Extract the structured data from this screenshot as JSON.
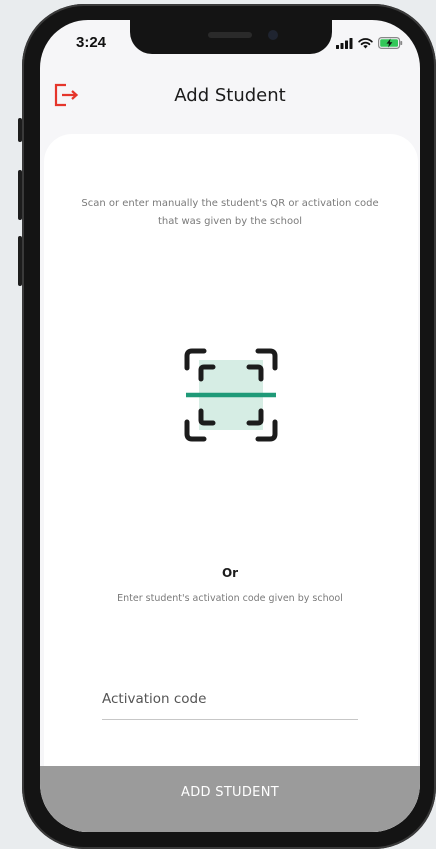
{
  "status_bar": {
    "time": "3:24",
    "icons": [
      "signal-icon",
      "wifi-icon",
      "battery-charging-icon"
    ]
  },
  "header": {
    "title": "Add Student",
    "logout_icon": "logout-icon"
  },
  "main": {
    "instructions": "Scan or enter manually the student's QR or activation code that was given by the school",
    "qr_icon": "qr-scan-icon",
    "or_label": "Or",
    "enter_text": "Enter student's activation code given by school",
    "activation_placeholder": "Activation code",
    "activation_value": ""
  },
  "footer": {
    "add_button_label": "ADD STUDENT"
  },
  "colors": {
    "accent_red": "#e5352b",
    "scan_green": "#1f9a78",
    "scan_fill": "#d6ede4",
    "button_gray": "#9b9b9b"
  }
}
